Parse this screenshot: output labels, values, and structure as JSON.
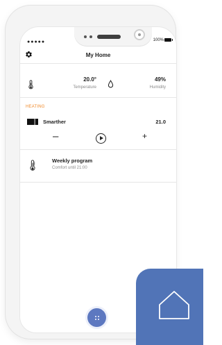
{
  "status_bar": {
    "signal": "●●●●● ",
    "battery_percent": "100%"
  },
  "header": {
    "title": "My Home"
  },
  "climate": {
    "temperature": {
      "value": "20.0°",
      "label": "Temperature"
    },
    "humidity": {
      "value": "49%",
      "label": "Humidity"
    }
  },
  "heating": {
    "section_title": "HEATING",
    "device": {
      "name": "Smarther",
      "setpoint": "21.0",
      "minus_label": "–",
      "plus_label": "+"
    },
    "program": {
      "title": "Weekly program",
      "subtitle": "Comfort until 21:00"
    }
  },
  "icons": {
    "settings": "gear-icon",
    "temperature": "thermometer-icon",
    "humidity": "droplet-icon",
    "device": "smarther-device-icon",
    "program": "thermometer-program-icon",
    "fab": "grid-icon",
    "app": "home-icon"
  },
  "colors": {
    "accent_orange": "#f08a2b",
    "app_blue": "#5174b7",
    "fab_blue": "#5d78c0"
  }
}
